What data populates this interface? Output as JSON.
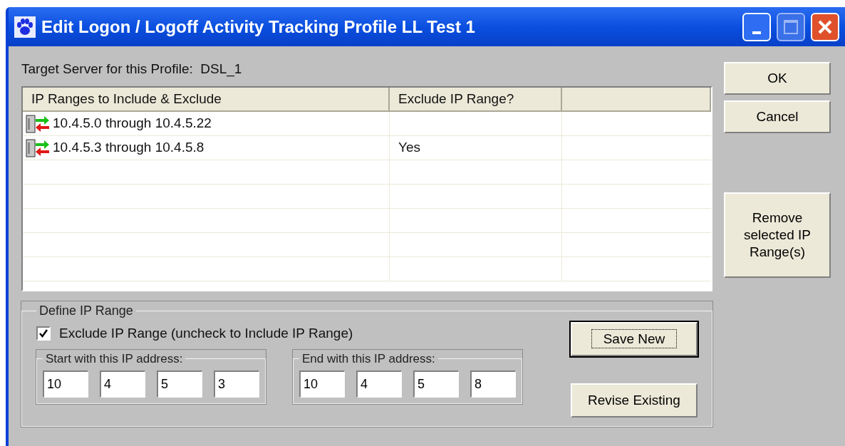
{
  "window": {
    "title": "Edit Logon / Logoff Activity Tracking Profile LL Test 1"
  },
  "target_server": "Target Server for this Profile:  DSL_1",
  "table": {
    "columns": [
      "IP Ranges to Include & Exclude",
      "Exclude IP Range?"
    ],
    "rows": [
      {
        "range": "10.4.5.0 through 10.4.5.22"
      },
      {
        "range": "10.4.5.3 through 10.4.5.8",
        "exclude": "Yes"
      }
    ]
  },
  "side_buttons": [
    {
      "label": "OK"
    },
    {
      "label": "Cancel"
    }
  ],
  "remove_button": "Remove selected IP Range(s)",
  "define": {
    "title": "Define IP Range",
    "exclude_checkbox": {
      "label": "Exclude IP Range (uncheck to Include IP Range)",
      "checked": true
    },
    "start": {
      "title": "Start with this IP address:",
      "octets": [
        "10",
        "4",
        "5",
        "3"
      ]
    },
    "end": {
      "title": "End with this IP address:",
      "octets": [
        "10",
        "4",
        "5",
        "8"
      ]
    },
    "save_button": {
      "label": "Save New",
      "focused": true
    },
    "revise_button": "Revise Existing"
  }
}
